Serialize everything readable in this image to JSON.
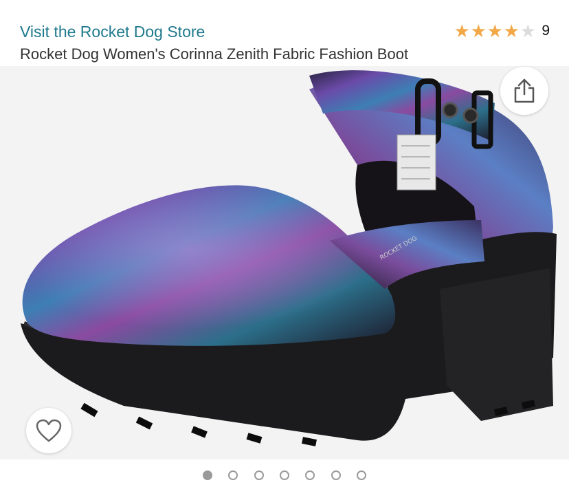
{
  "header": {
    "store_link": "Visit the Rocket Dog Store",
    "product_title": "Rocket Dog Women's Corinna Zenith Fabric Fashion Boot",
    "rating": {
      "value": 4,
      "max": 5,
      "count": "9"
    }
  },
  "gallery": {
    "image_count": 7,
    "active_index": 0,
    "image_brand_text": "ROCKET DOG"
  },
  "icons": {
    "share": "share-icon",
    "wishlist": "heart-icon",
    "star": "star-icon"
  },
  "colors": {
    "link": "#1f7a8c",
    "star": "#f3a847",
    "star_empty": "#dcdcdc",
    "image_bg": "#f3f3f3",
    "dot": "#9a9a9a"
  }
}
